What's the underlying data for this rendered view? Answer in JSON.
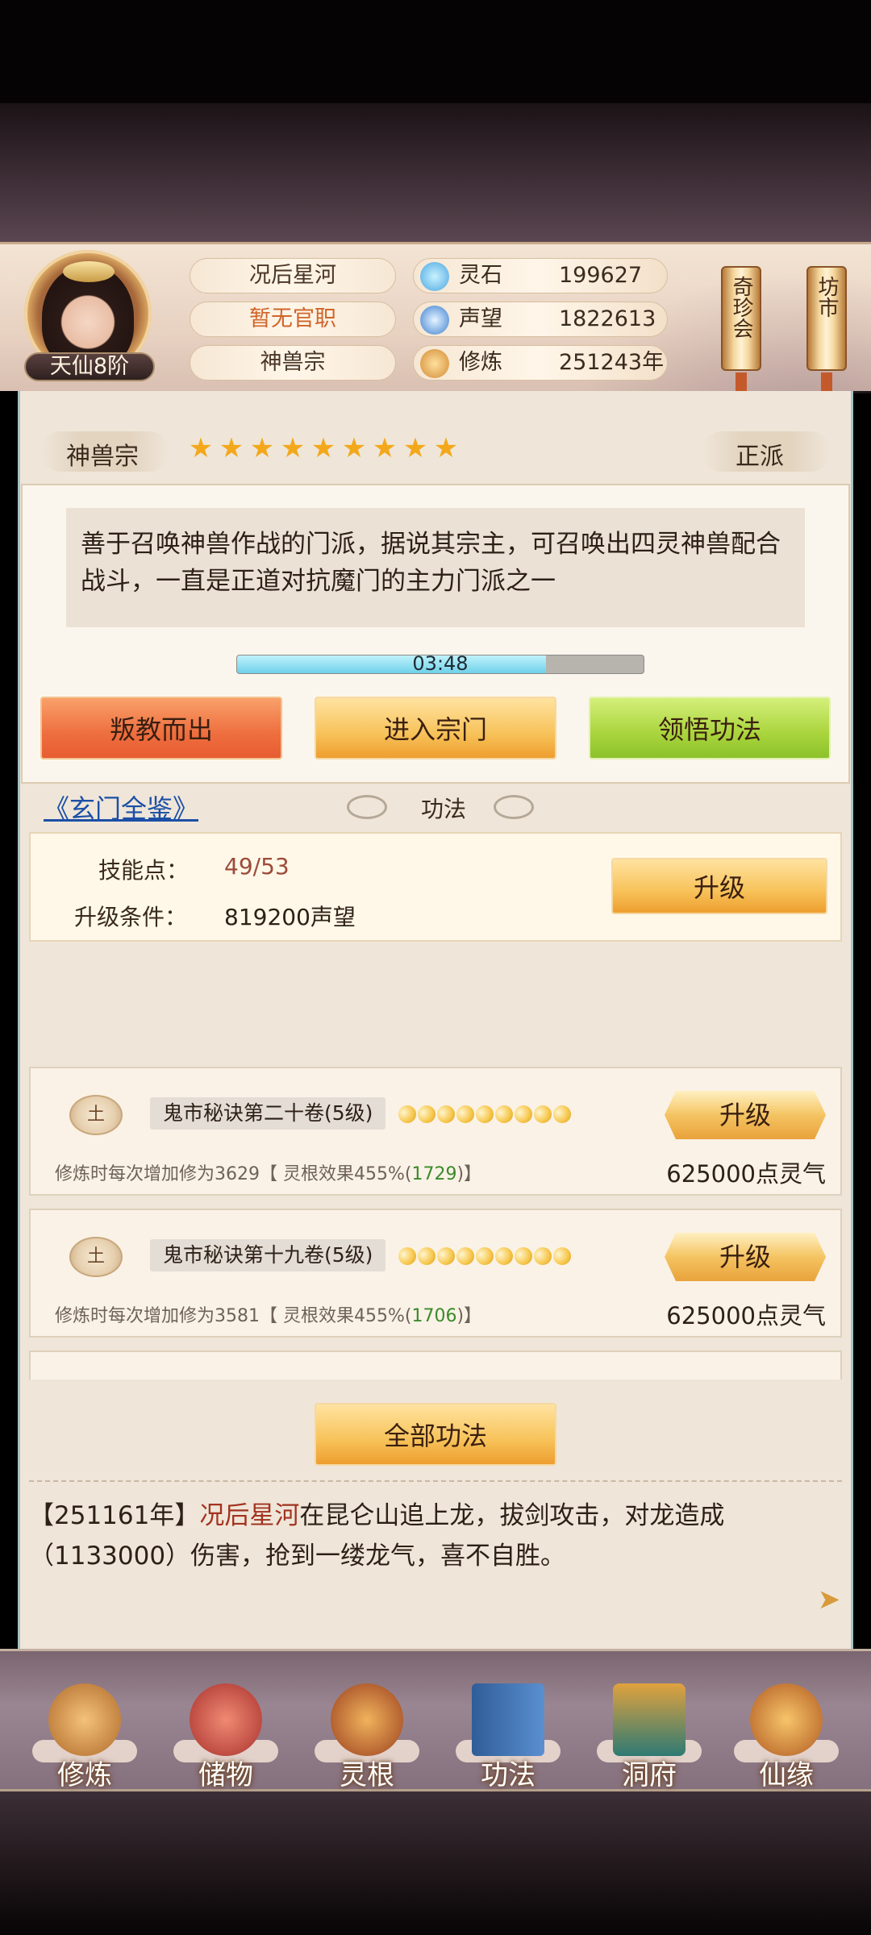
{
  "profile": {
    "rank": "天仙8阶",
    "name": "况后星河",
    "official_title": "暂无官职",
    "sect": "神兽宗"
  },
  "stats": [
    {
      "label": "灵石",
      "value": "199627",
      "icon": "spirit-stone-icon"
    },
    {
      "label": "声望",
      "value": "1822613",
      "icon": "prestige-icon"
    },
    {
      "label": "修炼",
      "value": "251243年",
      "icon": "meditation-icon"
    }
  ],
  "top_scrolls": {
    "treasure": "奇珍会",
    "market": "坊市"
  },
  "sect_info": {
    "name": "神兽宗",
    "stars": 9,
    "alignment": "正派",
    "description": "善于召唤神兽作战的门派，据说其宗主，可召唤出四灵神兽配合战斗，一直是正道对抗魔门的主力门派之一",
    "timer": "03:48",
    "timer_progress": 0.76
  },
  "actions": {
    "betray": "叛教而出",
    "enter": "进入宗门",
    "comprehend": "领悟功法"
  },
  "codex_link": "《玄门全鉴》",
  "section_title": "功法",
  "skill_points": {
    "label": "技能点：",
    "value": "49/53",
    "condition_label": "升级条件：",
    "condition_value": "819200声望",
    "upgrade": "升级"
  },
  "gongfa_list": [
    {
      "element": "土",
      "name": "鬼市秘诀第二十卷(5级)",
      "moons": 9,
      "upgrade": "升级",
      "desc_prefix": "修炼时每次增加修为3629【 灵根效果455%(",
      "desc_highlight": "1729",
      "desc_suffix": ")】",
      "cost": "625000点灵气"
    },
    {
      "element": "土",
      "name": "鬼市秘诀第十九卷(5级)",
      "moons": 9,
      "upgrade": "升级",
      "desc_prefix": "修炼时每次增加修为3581【 灵根效果455%(",
      "desc_highlight": "1706",
      "desc_suffix": ")】",
      "cost": "625000点灵气"
    }
  ],
  "all_gongfa": "全部功法",
  "log": {
    "year": "【251161年】",
    "name": "况后星河",
    "text": "在昆仑山追上龙，拔剑攻击，对龙造成（1133000）伤害，抢到一缕龙气，喜不自胜。"
  },
  "nav": [
    {
      "label": "修炼",
      "icon": "cultivate-icon",
      "color": "#d08a3c"
    },
    {
      "label": "储物",
      "icon": "storage-bag-icon",
      "color": "#c9473c"
    },
    {
      "label": "灵根",
      "icon": "spirit-root-icon",
      "color": "#b8542a"
    },
    {
      "label": "功法",
      "icon": "gongfa-book-icon",
      "color": "#3d6fa8"
    },
    {
      "label": "洞府",
      "icon": "cave-mansion-icon",
      "color": "#2e7a74"
    },
    {
      "label": "仙缘",
      "icon": "gourd-icon",
      "color": "#c86a2a"
    }
  ],
  "colors": {
    "accent_gold": "#f7c259",
    "link_blue": "#1c4fa6",
    "highlight_red": "#a2331f",
    "value_red": "#9d4a3a",
    "green": "#3a8a2a"
  }
}
